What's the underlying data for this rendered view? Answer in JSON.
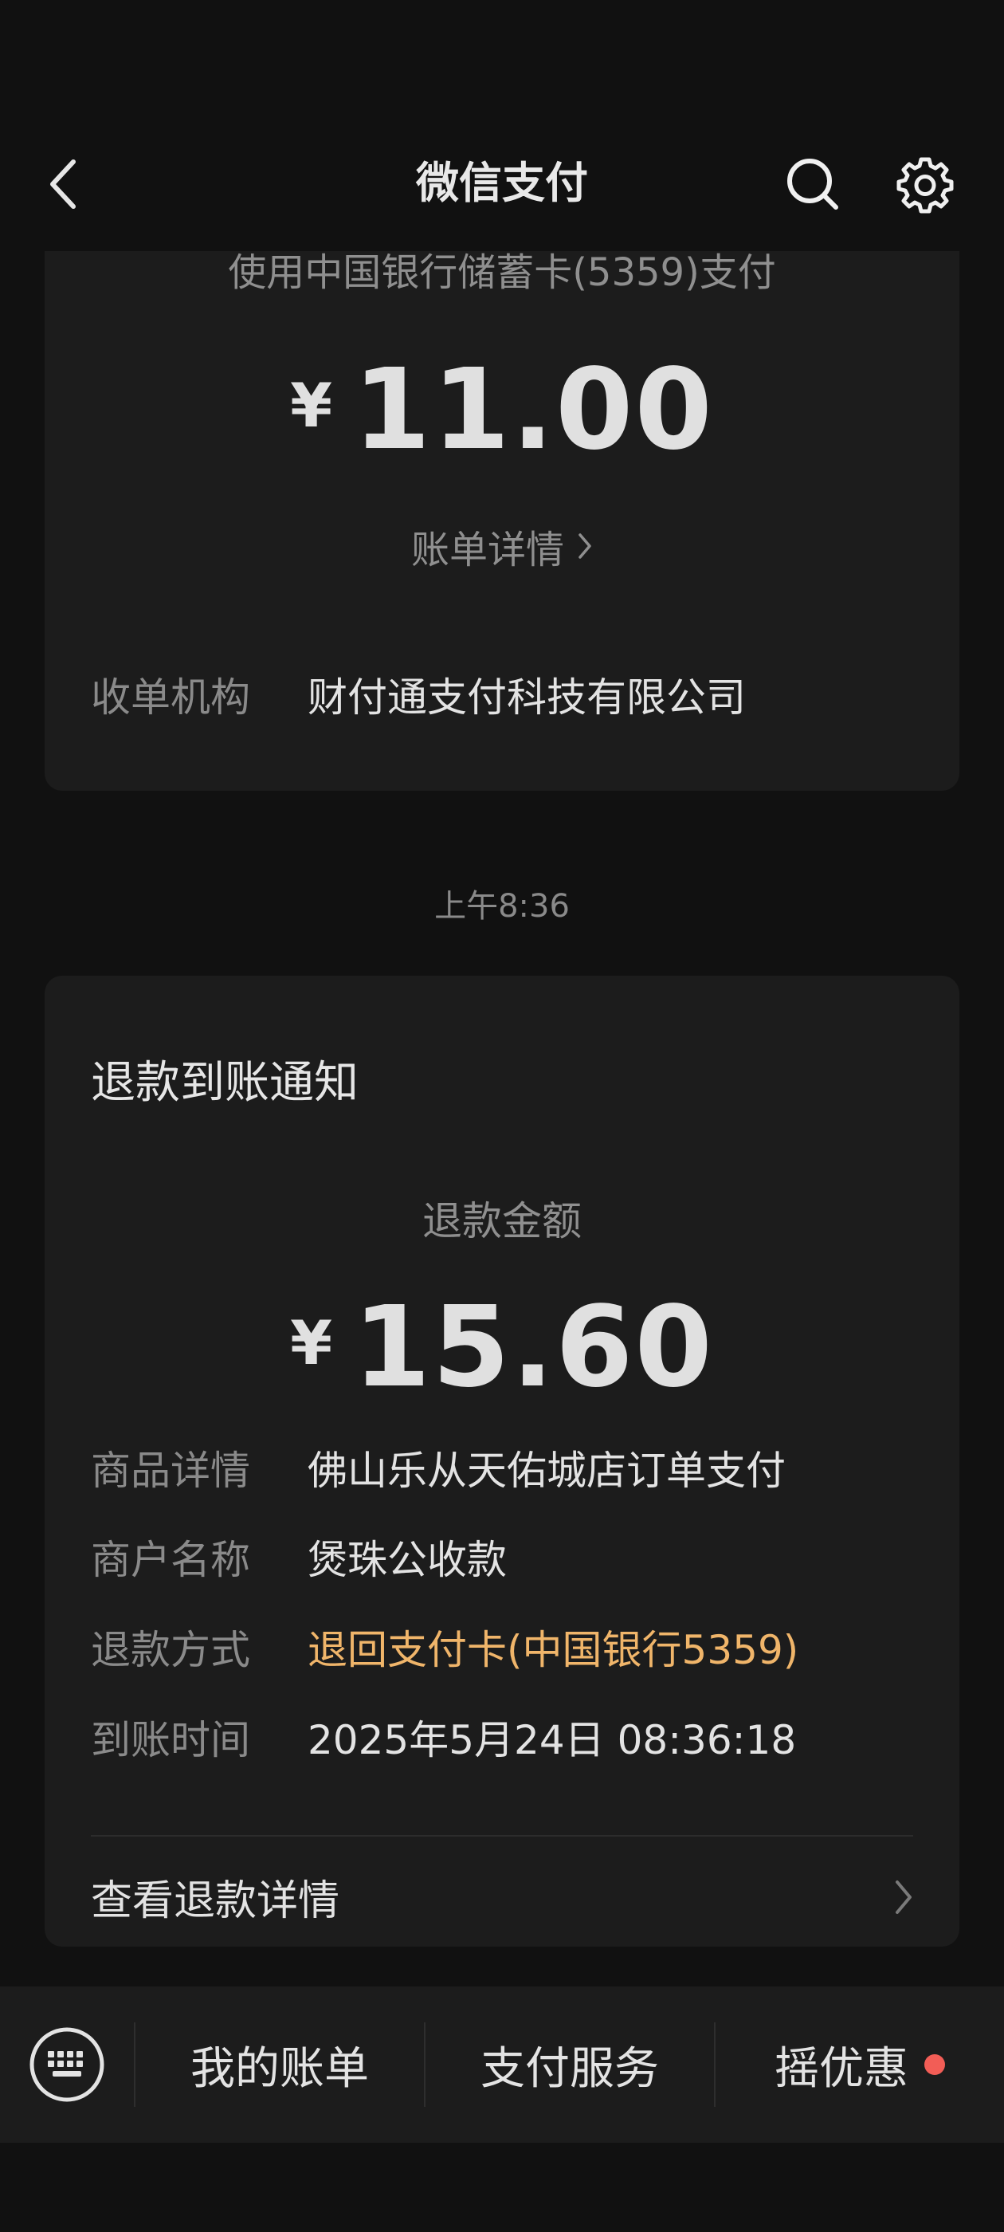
{
  "header": {
    "title": "微信支付",
    "back_icon": "chevron-left-icon",
    "search_icon": "search-icon",
    "settings_icon": "gear-icon"
  },
  "payment_card": {
    "pay_method": "使用中国银行储蓄卡(5359)支付",
    "currency": "¥",
    "amount": "11.00",
    "bill_link": "账单详情",
    "rows": [
      {
        "label": "收单机构",
        "value": "财付通支付科技有限公司"
      }
    ]
  },
  "time_separator": "上午8:36",
  "refund_card": {
    "title": "退款到账通知",
    "amount_label": "退款金额",
    "currency": "¥",
    "amount": "15.60",
    "rows": [
      {
        "label": "商品详情",
        "value": "佛山乐从天佑城店订单支付"
      },
      {
        "label": "商户名称",
        "value": "煲珠公收款"
      },
      {
        "label": "退款方式",
        "value": "退回支付卡(中国银行5359)"
      },
      {
        "label": "到账时间",
        "value": "2025年5月24日 08:36:18"
      }
    ],
    "detail_link": "查看退款详情"
  },
  "bottom_bar": {
    "keyboard_icon": "keyboard-icon",
    "items": [
      "我的账单",
      "支付服务",
      "摇优惠"
    ]
  },
  "colors": {
    "background": "#111111",
    "card": "#1c1c1c",
    "accent_orange": "#f0b56a",
    "notification_dot": "#f25d56"
  }
}
